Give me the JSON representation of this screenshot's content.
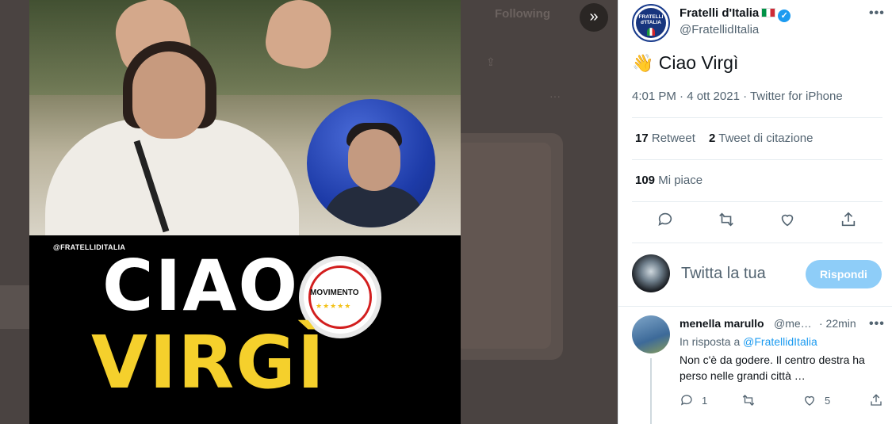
{
  "background": {
    "following_label": "Following"
  },
  "media": {
    "poster_handle": "@FRATELLIDITALIA",
    "headline_line1": "CIAO",
    "headline_line2": "VIRGÌ",
    "logo_text": "MOVIMENTO",
    "logo_stars": "★★★★★",
    "expand_icon": "»"
  },
  "tweet": {
    "author_name": "Fratelli d'Italia",
    "author_handle": "@FratellidItalia",
    "avatar_text": "FRATELLI d'ITALIA",
    "verified_icon": "✓",
    "more_icon": "•••",
    "wave_emoji": "👋",
    "text": "Ciao Virgì",
    "meta": "4:01 PM · 4 ott 2021 · Twitter for iPhone",
    "retweets_count": "17",
    "retweets_label": "Retweet",
    "quotes_count": "2",
    "quotes_label": "Tweet di citazione",
    "likes_count": "109",
    "likes_label": "Mi piace"
  },
  "composer": {
    "placeholder": "Twitta la tua",
    "reply_button": "Rispondi"
  },
  "comment": {
    "name": "menella marullo",
    "handle": "@me…",
    "time": "· 22min",
    "reply_prefix": "In risposta a",
    "reply_to": "@FratellidItalia",
    "text": "Non c'è da godere. Il centro destra ha perso nelle grandi città …",
    "reply_count": "1",
    "like_count": "5"
  },
  "colors": {
    "accent": "#1d9bf0",
    "reply_button_disabled": "#8ecdf8",
    "poster_yellow": "#f5d02c"
  }
}
